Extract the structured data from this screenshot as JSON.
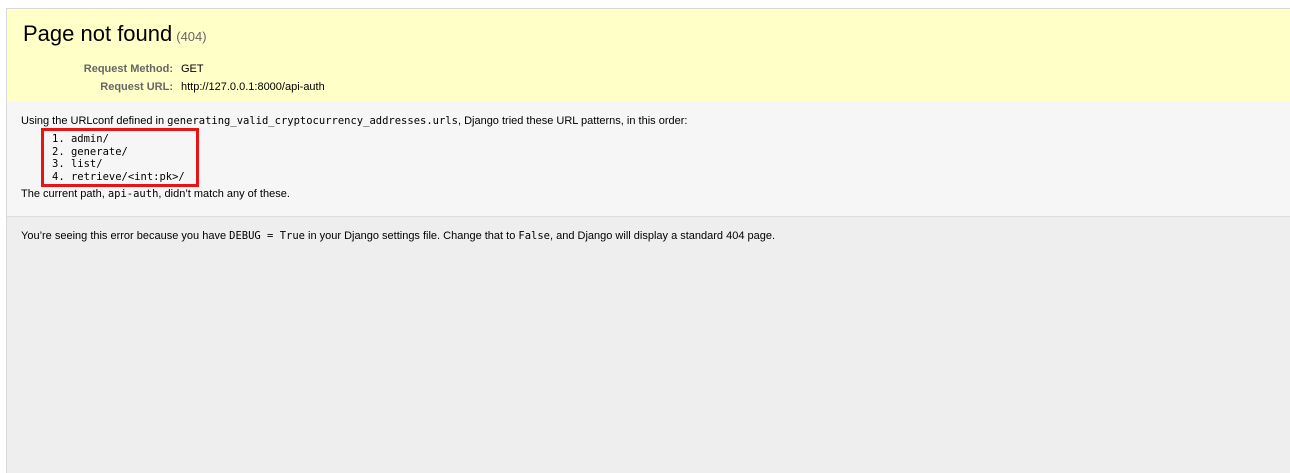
{
  "summary": {
    "title": "Page not found",
    "status_code": "(404)",
    "request_method_label": "Request Method:",
    "request_method_value": "GET",
    "request_url_label": "Request URL:",
    "request_url_value": "http://127.0.0.1:8000/api-auth"
  },
  "info": {
    "intro_prefix": "Using the URLconf defined in ",
    "urlconf": "generating_valid_cryptocurrency_addresses.urls",
    "intro_suffix": ", Django tried these URL patterns, in this order:",
    "patterns": [
      "admin/",
      "generate/",
      "list/",
      "retrieve/<int:pk>/"
    ],
    "current_prefix": "The current path, ",
    "current_path": "api-auth",
    "current_suffix": ", didn’t match any of these."
  },
  "explanation": {
    "prefix": "You’re seeing this error because you have ",
    "debug_setting": "DEBUG = True",
    "middle": " in your Django settings file. Change that to ",
    "false_value": "False",
    "suffix": ", and Django will display a standard 404 page."
  },
  "colors": {
    "summary_bg": "#ffffc8",
    "highlight_border": "#e61414",
    "body_bg": "#eeeeee"
  }
}
